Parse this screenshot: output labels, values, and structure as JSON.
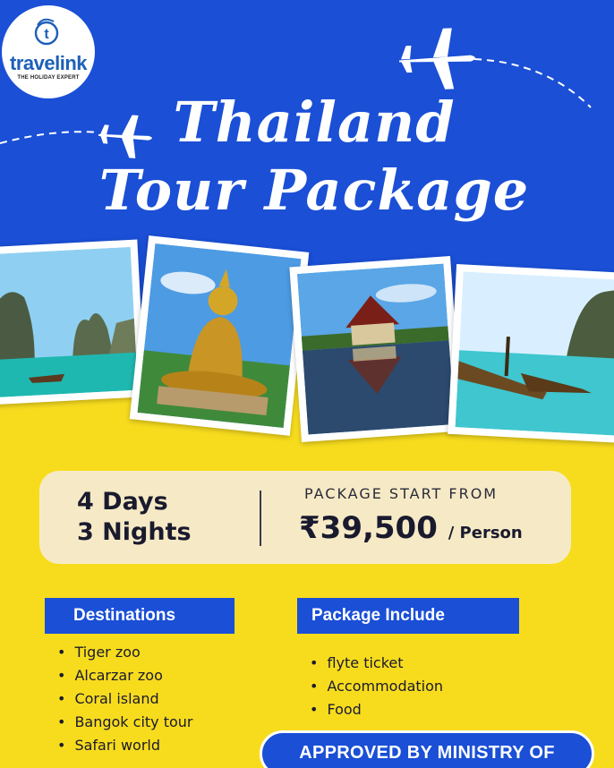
{
  "brand": {
    "logo_letter": "t",
    "name": "travelink",
    "tagline": "THE HOLIDAY EXPERT"
  },
  "title": {
    "line1": "Thailand",
    "line2": "Tour Package"
  },
  "photos": [
    {
      "subject": "limestone-island-photo"
    },
    {
      "subject": "golden-buddha-photo"
    },
    {
      "subject": "temple-reflection-photo"
    },
    {
      "subject": "longtail-boats-photo"
    }
  ],
  "package": {
    "days": "4 Days",
    "nights": "3 Nights",
    "start_label": "PACKAGE START FROM",
    "price": "₹39,500",
    "per": "/ Person"
  },
  "destinations": {
    "heading": "Destinations",
    "items": [
      "Tiger zoo",
      "Alcarzar zoo",
      "Coral island",
      "Bangok city tour",
      "Safari world"
    ]
  },
  "includes": {
    "heading": "Package Include",
    "items": [
      "flyte ticket",
      "Accommodation",
      "Food"
    ]
  },
  "badge": "APPROVED BY MINISTRY OF TOURISM",
  "colors": {
    "blue": "#1a4fd6",
    "yellow": "#f7dc1e",
    "card": "#f6eac6",
    "logo_blue": "#1d5fb8"
  }
}
